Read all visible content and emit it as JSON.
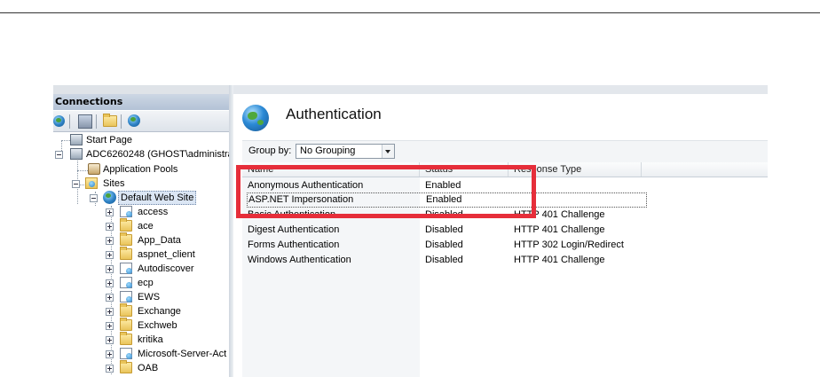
{
  "connections": {
    "header": "Connections",
    "tree": [
      {
        "id": "start-page",
        "label": "Start Page"
      },
      {
        "id": "server",
        "label": "ADC6260248 (GHOST\\administra"
      },
      {
        "id": "app-pools",
        "label": "Application Pools"
      },
      {
        "id": "sites",
        "label": "Sites"
      },
      {
        "id": "default-web-site",
        "label": "Default Web Site"
      },
      {
        "id": "access",
        "label": "access"
      },
      {
        "id": "ace",
        "label": "ace"
      },
      {
        "id": "app-data",
        "label": "App_Data"
      },
      {
        "id": "aspnet-client",
        "label": "aspnet_client"
      },
      {
        "id": "autodiscover",
        "label": "Autodiscover"
      },
      {
        "id": "ecp",
        "label": "ecp"
      },
      {
        "id": "ews",
        "label": "EWS"
      },
      {
        "id": "exchange",
        "label": "Exchange"
      },
      {
        "id": "exchweb",
        "label": "Exchweb"
      },
      {
        "id": "kritika",
        "label": "kritika"
      },
      {
        "id": "ms-server-act",
        "label": "Microsoft-Server-Act"
      },
      {
        "id": "oab",
        "label": "OAB"
      }
    ]
  },
  "feature": {
    "title": "Authentication",
    "group_by_label": "Group by:",
    "group_by_value": "No Grouping"
  },
  "table": {
    "columns": [
      "Name",
      "Status",
      "Response Type"
    ],
    "rows": [
      {
        "name": "Anonymous Authentication",
        "status": "Enabled",
        "response": ""
      },
      {
        "name": "ASP.NET Impersonation",
        "status": "Enabled",
        "response": ""
      },
      {
        "name": "Basic Authentication",
        "status": "Disabled",
        "response": "HTTP 401 Challenge"
      },
      {
        "name": "Digest Authentication",
        "status": "Disabled",
        "response": "HTTP 401 Challenge"
      },
      {
        "name": "Forms Authentication",
        "status": "Disabled",
        "response": "HTTP 302 Login/Redirect"
      },
      {
        "name": "Windows Authentication",
        "status": "Disabled",
        "response": "HTTP 401 Challenge"
      }
    ]
  },
  "colors": {
    "highlight": "#e62e3a",
    "connections_header": "#b3c2d6"
  }
}
